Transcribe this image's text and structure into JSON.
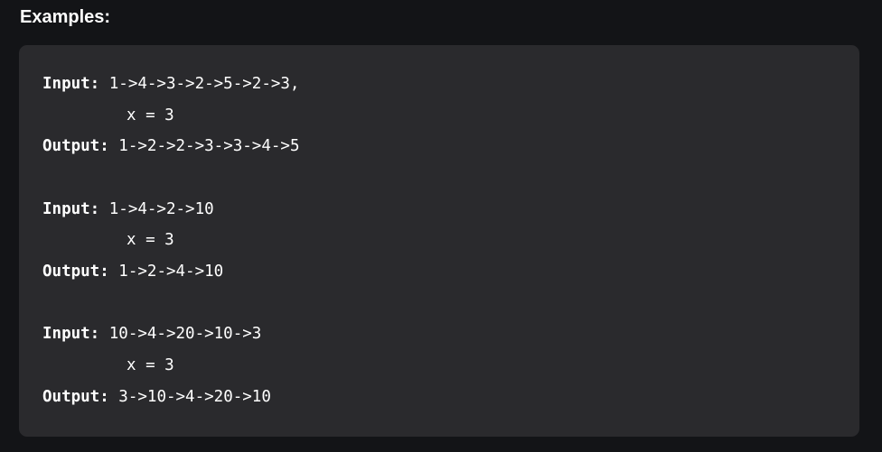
{
  "section": {
    "title": "Examples:"
  },
  "examples": [
    {
      "input_label": "Input:",
      "input_value": " 1->4->3->2->5->2->3,",
      "x_value": "x = 3",
      "output_label": "Output:",
      "output_value": " 1->2->2->3->3->4->5"
    },
    {
      "input_label": "Input:",
      "input_value": " 1->4->2->10",
      "x_value": "x = 3",
      "output_label": "Output:",
      "output_value": " 1->2->4->10"
    },
    {
      "input_label": "Input:",
      "input_value": " 10->4->20->10->3",
      "x_value": "x = 3",
      "output_label": "Output:",
      "output_value": " 3->10->4->20->10"
    }
  ]
}
